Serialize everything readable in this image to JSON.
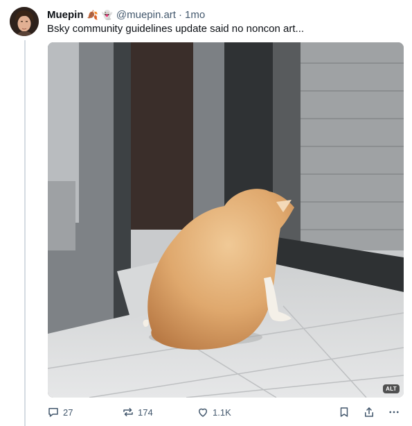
{
  "post": {
    "author": {
      "display_name": "Muepin",
      "emoji": [
        "🍂",
        "👻"
      ],
      "handle": "@muepin.art",
      "separator": "·",
      "timestamp": "1mo"
    },
    "text": "Bsky community guidelines update said no noncon art...",
    "media": {
      "badge": "ALT",
      "icon": "image"
    },
    "actions": {
      "reply": {
        "icon": "reply-icon",
        "count": "27"
      },
      "repost": {
        "icon": "repost-icon",
        "count": "174"
      },
      "like": {
        "icon": "heart-icon",
        "count": "1.1K"
      },
      "bookmark": {
        "icon": "bookmark-icon"
      },
      "share": {
        "icon": "share-icon"
      },
      "more": {
        "icon": "more-icon"
      }
    }
  },
  "colors": {
    "text_primary": "#0b0f14",
    "text_secondary": "#42576c",
    "thread_line": "#d4dbe2"
  }
}
